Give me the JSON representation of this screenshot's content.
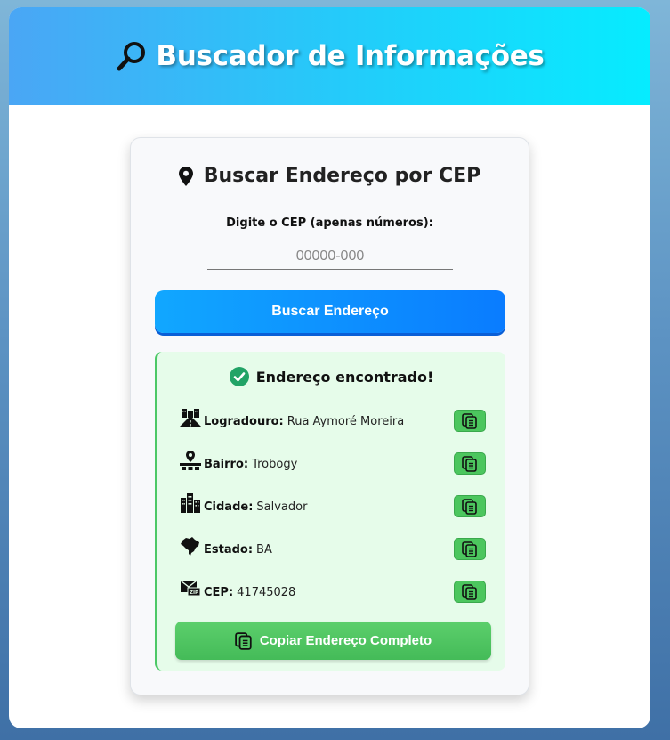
{
  "header": {
    "title": "Buscador de Informações",
    "icon": "magnifier-icon"
  },
  "search_card": {
    "title": "Buscar Endereço por CEP",
    "icon": "map-pin-icon",
    "input_label": "Digite o CEP (apenas números):",
    "input_placeholder": "00000-000",
    "input_value": "",
    "button_label": "Buscar Endereço"
  },
  "result": {
    "title": "Endereço encontrado!",
    "icon": "check-circle-icon",
    "rows": [
      {
        "icon": "street-icon",
        "label": "Logradouro:",
        "value": "Rua Aymoré Moreira"
      },
      {
        "icon": "neighborhood-icon",
        "label": "Bairro:",
        "value": "Trobogy"
      },
      {
        "icon": "city-icon",
        "label": "Cidade:",
        "value": "Salvador"
      },
      {
        "icon": "brazil-map-icon",
        "label": "Estado:",
        "value": "BA"
      },
      {
        "icon": "zip-envelope-icon",
        "label": "CEP:",
        "value": "41745028"
      }
    ],
    "copy_all_label": "Copiar Endereço Completo"
  },
  "colors": {
    "header_gradient": [
      "#4aa6f5",
      "#06ecff"
    ],
    "search_button": "#0a7cff",
    "success_green": "#4cc866",
    "result_background": "#e6fcea"
  }
}
